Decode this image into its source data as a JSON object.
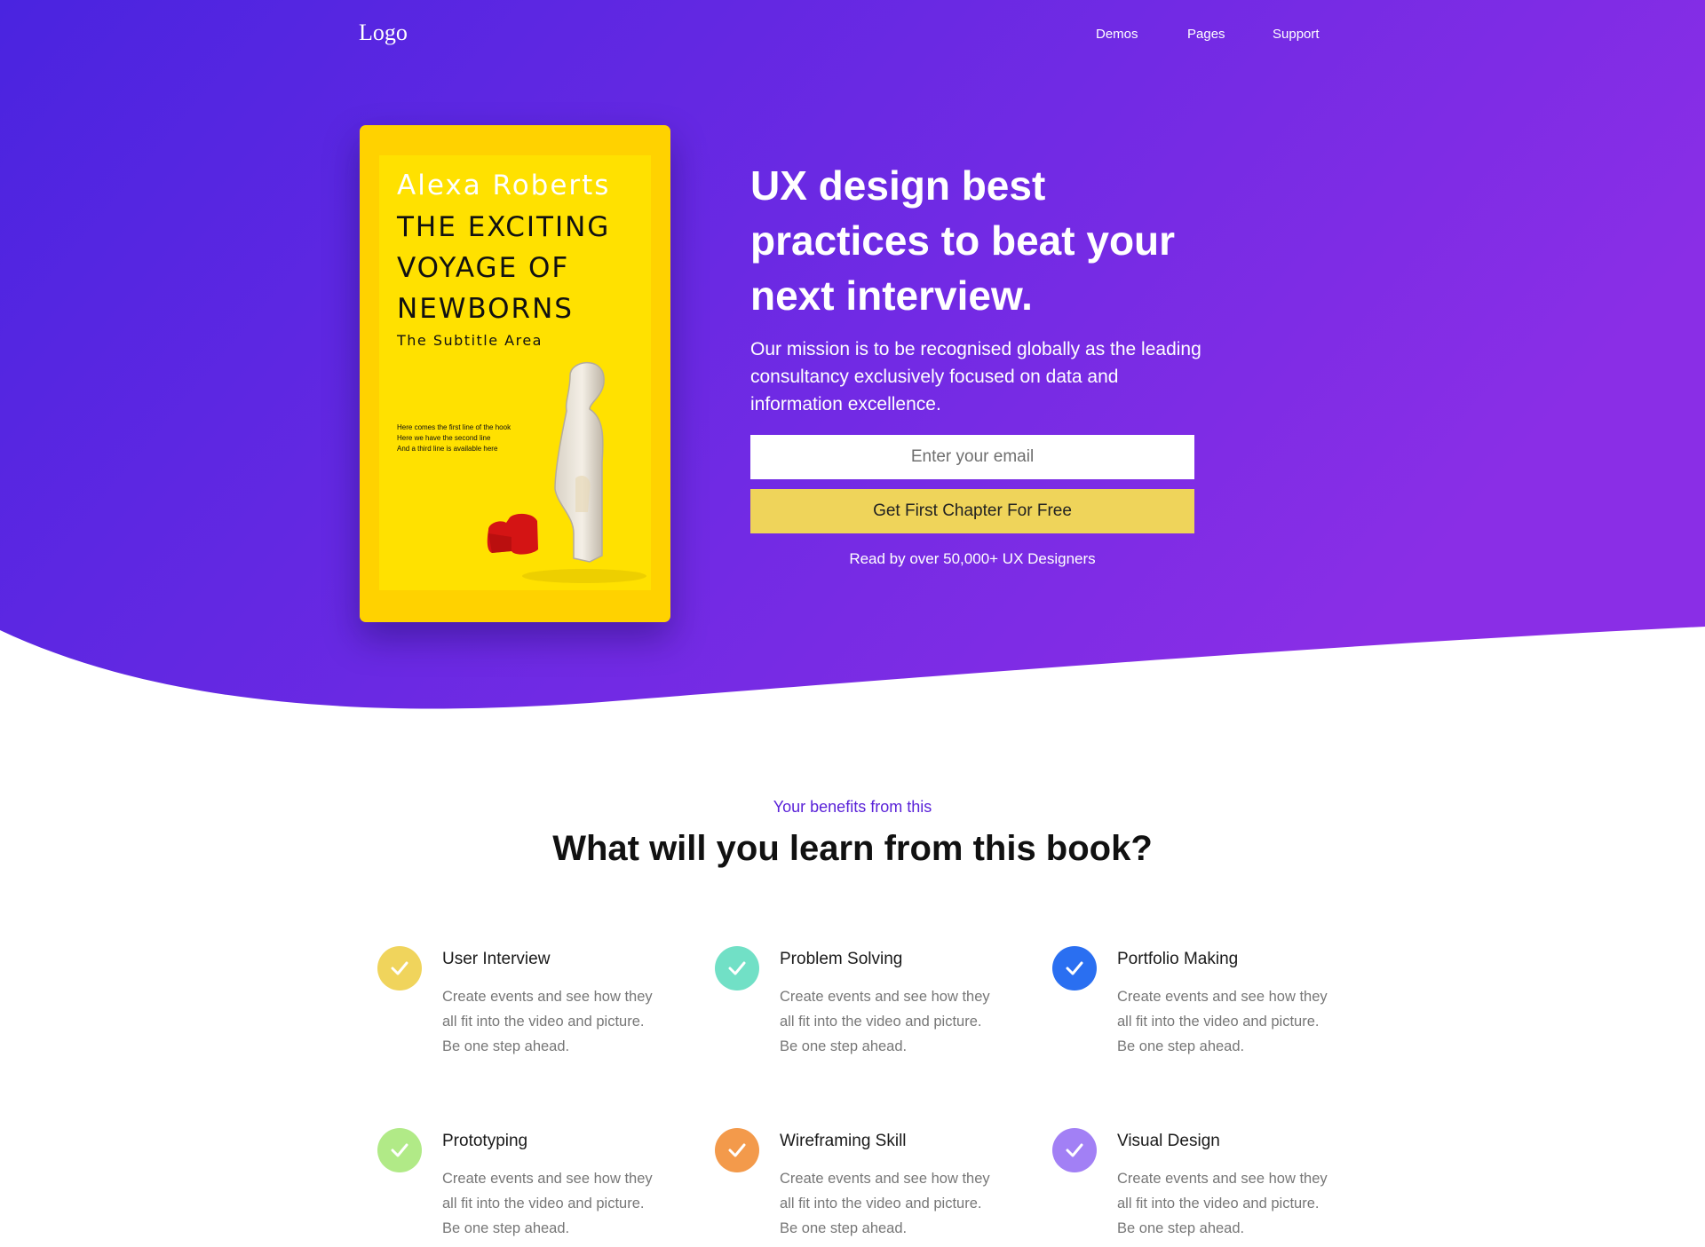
{
  "nav": {
    "logo": "Logo",
    "links": [
      "Demos",
      "Pages",
      "Support"
    ]
  },
  "book": {
    "author": "Alexa Roberts",
    "title": "THE EXCITING VOYAGE OF NEWBORNS",
    "subtitle": "The Subtitle Area",
    "hook_lines": [
      "Here comes the first line of the hook",
      "Here we have the second line",
      "And a third line is available here"
    ]
  },
  "hero": {
    "headline": "UX design best practices to beat your next interview.",
    "mission": "Our mission is to be recognised globally as the leading consultancy exclusively focused on data and information excellence.",
    "email_placeholder": "Enter your email",
    "cta_label": "Get First Chapter For Free",
    "readers_note": "Read by over 50,000+ UX Designers"
  },
  "benefits": {
    "eyebrow": "Your benefits from this",
    "title": "What will you learn from this book?",
    "items": [
      {
        "title": "User Interview",
        "desc": "Create events and see how they all fit into the video and picture. Be one step ahead.",
        "color": "#f0d45c"
      },
      {
        "title": "Problem Solving",
        "desc": "Create events and see how they all fit into the video and picture. Be one step ahead.",
        "color": "#71e0c6"
      },
      {
        "title": "Portfolio Making",
        "desc": "Create events and see how they all fit into the video and picture. Be one step ahead.",
        "color": "#2a6ff1"
      },
      {
        "title": "Prototyping",
        "desc": "Create events and see how they all fit into the video and picture. Be one step ahead.",
        "color": "#b1ea87"
      },
      {
        "title": "Wireframing Skill",
        "desc": "Create events and see how they all fit into the video and picture. Be one step ahead.",
        "color": "#f39a4b"
      },
      {
        "title": "Visual Design",
        "desc": "Create events and see how they all fit into the video and picture. Be one step ahead.",
        "color": "#a280f5"
      }
    ]
  },
  "colors": {
    "hero_gradient_start": "#4a24e0",
    "hero_gradient_end": "#8a2ee6",
    "cta": "#efd45a",
    "accent": "#5a22d8",
    "book_cover": "#ffd200"
  },
  "icons": [
    "check-icon"
  ]
}
